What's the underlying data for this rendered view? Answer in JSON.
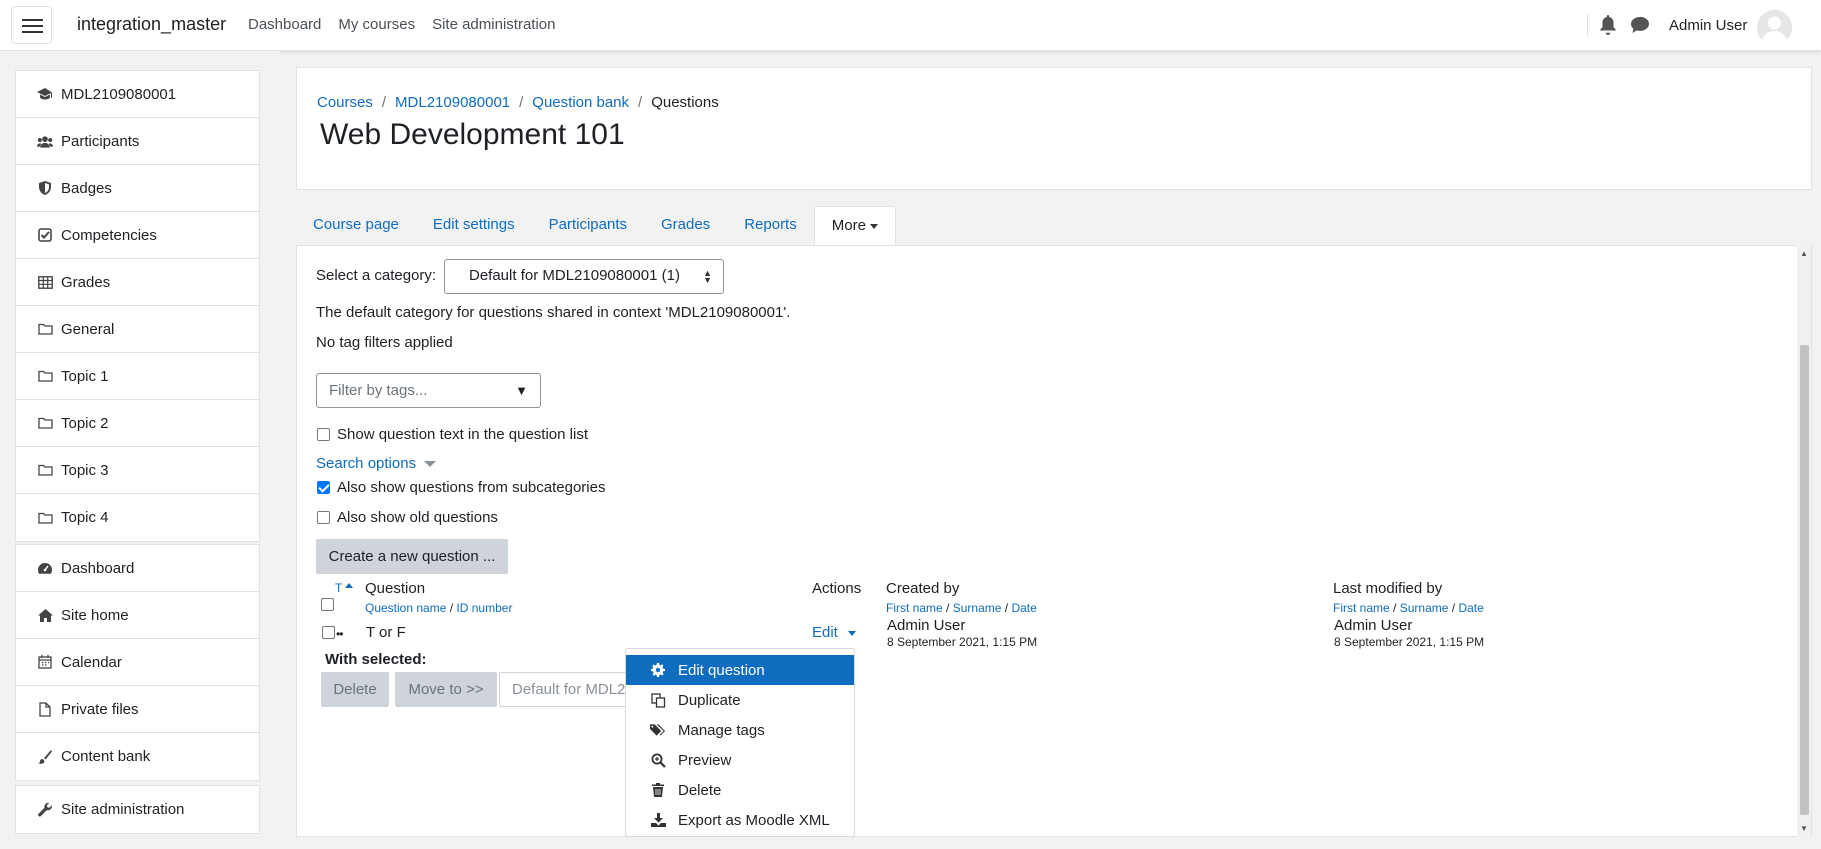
{
  "navbar": {
    "site_name": "integration_master",
    "links": [
      "Dashboard",
      "My courses",
      "Site administration"
    ],
    "user_name": "Admin User"
  },
  "drawer": {
    "course_items": [
      {
        "label": "MDL2109080001",
        "icon": "graduation-cap-icon"
      },
      {
        "label": "Participants",
        "icon": "users-icon"
      },
      {
        "label": "Badges",
        "icon": "shield-icon"
      },
      {
        "label": "Competencies",
        "icon": "check-square-icon"
      },
      {
        "label": "Grades",
        "icon": "table-icon"
      },
      {
        "label": "General",
        "icon": "folder-icon"
      },
      {
        "label": "Topic 1",
        "icon": "folder-icon"
      },
      {
        "label": "Topic 2",
        "icon": "folder-icon"
      },
      {
        "label": "Topic 3",
        "icon": "folder-icon"
      },
      {
        "label": "Topic 4",
        "icon": "folder-icon"
      }
    ],
    "site_items": [
      {
        "label": "Dashboard",
        "icon": "tachometer-icon"
      },
      {
        "label": "Site home",
        "icon": "home-icon"
      },
      {
        "label": "Calendar",
        "icon": "calendar-icon"
      },
      {
        "label": "Private files",
        "icon": "file-icon"
      },
      {
        "label": "Content bank",
        "icon": "paint-brush-icon"
      }
    ],
    "admin_item": {
      "label": "Site administration",
      "icon": "wrench-icon"
    }
  },
  "breadcrumb": [
    "Courses",
    "MDL2109080001",
    "Question bank",
    "Questions"
  ],
  "page_title": "Web Development 101",
  "tabs": [
    "Course page",
    "Edit settings",
    "Participants",
    "Grades",
    "Reports",
    "More"
  ],
  "question_bank": {
    "category_label": "Select a category:",
    "category_value": "Default for MDL2109080001 (1)",
    "category_info": "The default category for questions shared in context 'MDL2109080001'.",
    "tag_status": "No tag filters applied",
    "filter_placeholder": "Filter by tags...",
    "show_text_label": "Show question text in the question list",
    "search_options_label": "Search options",
    "subcategories_label": "Also show questions from subcategories",
    "old_questions_label": "Also show old questions",
    "create_button": "Create a new question ...",
    "table": {
      "col_type": "T",
      "col_question": "Question",
      "sub_question_name": "Question name",
      "sub_id_number": "ID number",
      "col_actions": "Actions",
      "col_created": "Created by",
      "col_modified": "Last modified by",
      "sub_first_name": "First name",
      "sub_surname": "Surname",
      "sub_date": "Date",
      "sep": "/"
    },
    "rows": [
      {
        "name": "T or F",
        "action": "Edit",
        "created_by": "Admin User",
        "created_date": "8 September 2021, 1:15 PM",
        "modified_by": "Admin User",
        "modified_date": "8 September 2021, 1:15 PM"
      }
    ],
    "with_selected": "With selected:",
    "delete_button": "Delete",
    "move_button": "Move to >>",
    "move_target": "Default for MDL2"
  },
  "action_menu": [
    {
      "label": "Edit question",
      "icon": "gear-icon",
      "active": true
    },
    {
      "label": "Duplicate",
      "icon": "copy-icon",
      "active": false
    },
    {
      "label": "Manage tags",
      "icon": "tags-icon",
      "active": false
    },
    {
      "label": "Preview",
      "icon": "search-plus-icon",
      "active": false
    },
    {
      "label": "Delete",
      "icon": "trash-icon",
      "active": false
    },
    {
      "label": "Export as Moodle XML",
      "icon": "download-icon",
      "active": false
    }
  ],
  "colors": {
    "link": "#0f6cbf",
    "active_menu": "#0f6cbf",
    "checkbox_checked": "#0075ff"
  }
}
